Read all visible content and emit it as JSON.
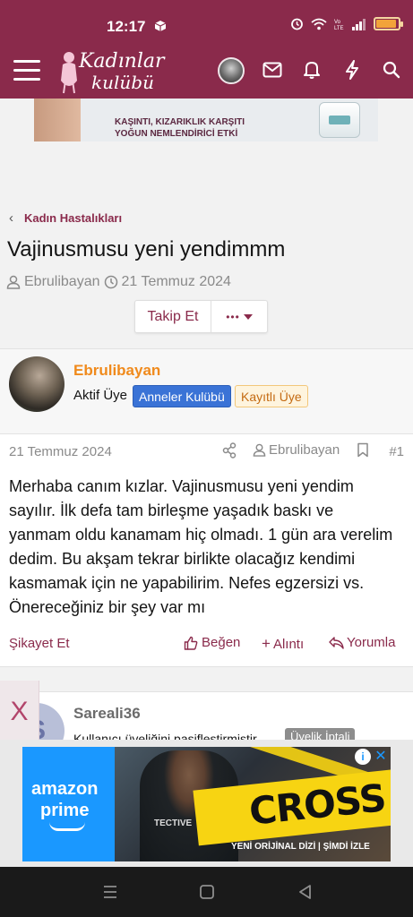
{
  "status_bar": {
    "time": "12:17"
  },
  "header": {
    "logo_line1": "Kadınlar",
    "logo_line2": "kulübü"
  },
  "top_ad": {
    "line1": "KAŞINTI, KIZARIKLIK KARŞITI",
    "line2": "YOĞUN NEMLENDİRİCİ ETKİ"
  },
  "breadcrumb": {
    "label": "Kadın Hastalıkları"
  },
  "thread": {
    "title": "Vajinusmusu yeni yendimmm",
    "author": "Ebrulibayan",
    "date": "21 Temmuz 2024",
    "follow_label": "Takip Et",
    "more_label": "•••"
  },
  "post": {
    "username": "Ebrulibayan",
    "user_title": "Aktif Üye",
    "badge1": "Anneler Kulübü",
    "badge2": "Kayıtlı Üye",
    "date": "21 Temmuz 2024",
    "author": "Ebrulibayan",
    "number": "#1",
    "body": "Merhaba canım kızlar. Vajinusmusu yeni yendim sayılır. İlk defa tam birleşme yaşadık baskı ve yanmam oldu kanamam hiç olmadı. 1 gün ara verelim dedim. Bu akşam tekrar birlikte olacağız kendimi kasmamak için ne yapabilirim. Nefes egzersizi vs. Önereceğiniz bir şey var mı",
    "report_label": "Şikayet Et",
    "like_label": "Beğen",
    "quote_label": "Alıntı",
    "reply_label": "Yorumla"
  },
  "post2": {
    "avatar_letter": "S",
    "username": "Sareali36",
    "subtext": "Kullanıcı üyeliğini pasifleştirmiştir",
    "pill": "Üyelik İptali"
  },
  "close_label": "X",
  "bottom_ad": {
    "brand_line1": "amazon",
    "brand_line2": "prime",
    "title": "CROSS",
    "vest_text": "TECTIVE",
    "caption": "YENİ ORİJİNAL DİZİ | ŞİMDİ İZLE",
    "info": "i",
    "close": "✕"
  },
  "colors": {
    "brand": "#8a2a4b",
    "orange_name": "#f08a1c",
    "badge_blue": "#3a73d6",
    "ad_blue": "#1a98ff"
  }
}
